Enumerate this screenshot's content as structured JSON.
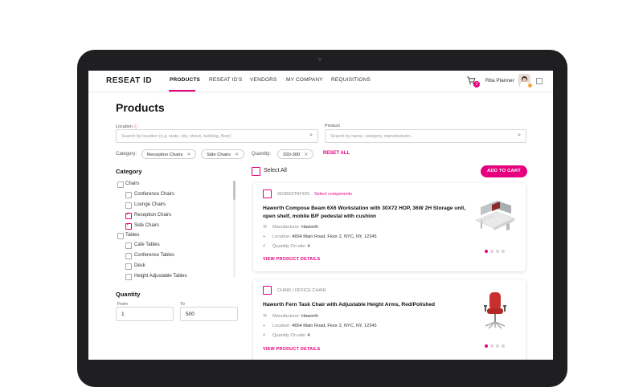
{
  "header": {
    "logo": "RESEAT ID",
    "nav": [
      {
        "label": "PRODUCTS",
        "active": true
      },
      {
        "label": "RESEAT ID'S"
      },
      {
        "label": "VENDORS"
      },
      {
        "label": "MY COMPANY"
      },
      {
        "label": "REQUISITIONS"
      }
    ],
    "cart_count": "3",
    "user_name": "Rita Planner"
  },
  "page": {
    "title": "Products",
    "location": {
      "label": "Location",
      "placeholder": "Search by location (e.g. state, city, street, building, floor)"
    },
    "product": {
      "label": "Product",
      "placeholder": "Search by name, category, manufacturer..."
    },
    "filters": {
      "category_label": "Category:",
      "category_chips": [
        "Reception Chairs",
        "Side Chairs"
      ],
      "quantity_label": "Quantity:",
      "quantity_chip": "200-300",
      "reset_label": "RESET ALL"
    }
  },
  "sidebar": {
    "category_heading": "Category",
    "categories": [
      {
        "label": "Chairs",
        "checked": false,
        "level": 0
      },
      {
        "label": "Conference Chairs",
        "checked": false,
        "level": 1
      },
      {
        "label": "Lounge Chairs",
        "checked": false,
        "level": 1
      },
      {
        "label": "Reception Chairs",
        "checked": true,
        "level": 1
      },
      {
        "label": "Side Chairs",
        "checked": true,
        "level": 1
      },
      {
        "label": "Tables",
        "checked": false,
        "level": 0
      },
      {
        "label": "Cafe Tables",
        "checked": false,
        "level": 1
      },
      {
        "label": "Conference Tables",
        "checked": false,
        "level": 1
      },
      {
        "label": "Desk",
        "checked": false,
        "level": 1
      },
      {
        "label": "Height Adjustable Tables",
        "checked": false,
        "level": 1
      }
    ],
    "quantity": {
      "heading": "Quantity",
      "from_label": "From",
      "to_label": "To",
      "from_value": "1",
      "to_value": "500"
    }
  },
  "list": {
    "select_all_label": "Select All",
    "add_to_cart_label": "ADD TO CART",
    "products": [
      {
        "type": "WORKSTATION",
        "type_link": "Select components",
        "name": "Haworth Compose Beam 6X6 Workstation with 30X72 HOP, 36W 2H Storage unit, open shelf, mobile B/F pedestal with cushion",
        "manufacturer_label": "Manufacturer:",
        "manufacturer": "Haworth",
        "location_label": "Location:",
        "location": "4654 Main Road, Floor 2, NYC, NY, 12345",
        "qty_label": "Quantity On-site:",
        "qty": "4",
        "details_label": "VIEW PRODUCT DETAILS",
        "image": "workstation-image"
      },
      {
        "type": "CHAIR / OFFICE CHAIR",
        "type_link": "",
        "name": "Haworth Fern Task Chair with Adjustable Height Arms, Red/Polished",
        "manufacturer_label": "Manufacturer:",
        "manufacturer": "Haworth",
        "location_label": "Location:",
        "location": "4654 Main Road, Floor 2, NYC, NY, 12345",
        "qty_label": "Quantity On-site:",
        "qty": "4",
        "details_label": "VIEW PRODUCT DETAILS",
        "image": "red-office-chair-image"
      }
    ]
  },
  "colors": {
    "accent": "#e6007e",
    "device": "#1f1f22"
  }
}
